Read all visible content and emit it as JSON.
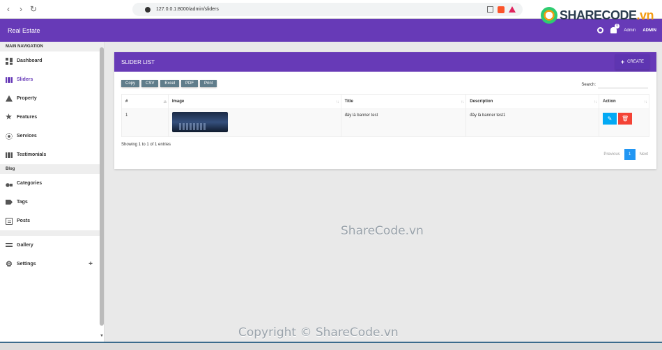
{
  "browser": {
    "url": "127.0.0.1:8000/admin/sliders"
  },
  "watermark_logo": {
    "text_main": "SHARECODE",
    "text_suffix": ".vn"
  },
  "header": {
    "brand": "Real Estate",
    "notification_count": "0",
    "user_label": "Admin",
    "user_role": "ADMIN"
  },
  "sidebar": {
    "main_nav_label": "MAIN NAVIGATION",
    "items": [
      {
        "label": "Dashboard",
        "icon": "dashboard-icon"
      },
      {
        "label": "Sliders",
        "icon": "slider-icon",
        "active": true
      },
      {
        "label": "Property",
        "icon": "home-icon"
      },
      {
        "label": "Features",
        "icon": "star-icon"
      },
      {
        "label": "Services",
        "icon": "sun-icon"
      },
      {
        "label": "Testimonials",
        "icon": "film-icon"
      }
    ],
    "blog_label": "Blog",
    "blog_items": [
      {
        "label": "Categories",
        "icon": "shapes-icon"
      },
      {
        "label": "Tags",
        "icon": "tag-icon"
      },
      {
        "label": "Posts",
        "icon": "posts-icon"
      }
    ],
    "bottom_items": [
      {
        "label": "Gallery",
        "icon": "list-icon"
      },
      {
        "label": "Settings",
        "icon": "gear-icon",
        "expand": "+"
      }
    ]
  },
  "card": {
    "title": "SLIDER LIST",
    "create_label": "CREATE",
    "export_buttons": [
      "Copy",
      "CSV",
      "Excel",
      "PDF",
      "Print"
    ],
    "search_label": "Search:",
    "columns": [
      "#",
      "Image",
      "Title",
      "Description",
      "Action"
    ],
    "rows": [
      {
        "num": "1",
        "title": "đây là banner test",
        "description": "đây là banner test1"
      }
    ],
    "info": "Showing 1 to 1 of 1 entries",
    "pagination": {
      "previous": "Previous",
      "current": "1",
      "next": "Next"
    }
  },
  "watermarks": {
    "center": "ShareCode.vn",
    "bottom": "Copyright © ShareCode.vn"
  },
  "colors": {
    "primary": "#673ab7",
    "edit": "#03a9f4",
    "delete": "#f44336",
    "page_active": "#2196f3",
    "export_btn": "#607d8b"
  }
}
